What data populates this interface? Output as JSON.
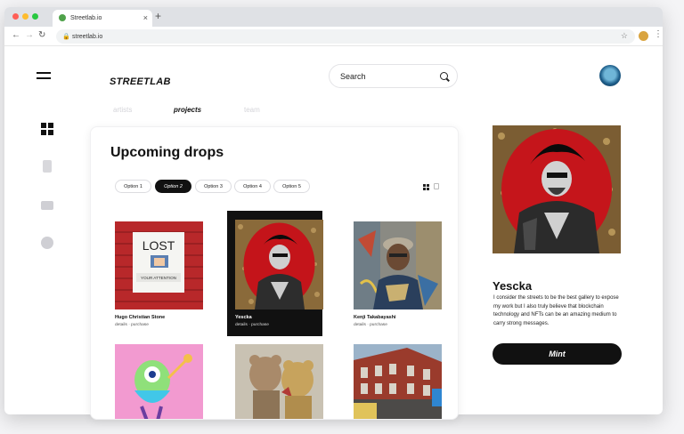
{
  "browser": {
    "tab_title": "Streetlab.io",
    "url": "streetlab.io",
    "new_tab": "+",
    "close_tab": "×"
  },
  "app": {
    "brand": "STREETLAB",
    "search_placeholder": "Search",
    "nav_tabs": [
      {
        "label": "artists"
      },
      {
        "label": "projects"
      },
      {
        "label": "team"
      }
    ]
  },
  "drops": {
    "title": "Upcoming drops",
    "filters": [
      "Option 1",
      "Option 2",
      "Option 3",
      "Option 4",
      "Option 5"
    ],
    "items": [
      {
        "name": "Hugo Christian Stone",
        "links": "details  ·  purchase"
      },
      {
        "name": "Yescka",
        "links": "details  ·  purchase"
      },
      {
        "name": "Kenji Takabayashi",
        "links": "details  ·  purchase"
      }
    ]
  },
  "featured": {
    "name": "Yescka",
    "description": "I consider the streets to be the best gallery to expose my work but I also truly believe that blockchain technology and NFTs can be an amazing medium to carry strong messages.",
    "mint_label": "Mint"
  },
  "colors": {
    "accent": "#111111",
    "tab_favicon": "#4fa24a",
    "muted_nav": "#d3d3d8"
  }
}
